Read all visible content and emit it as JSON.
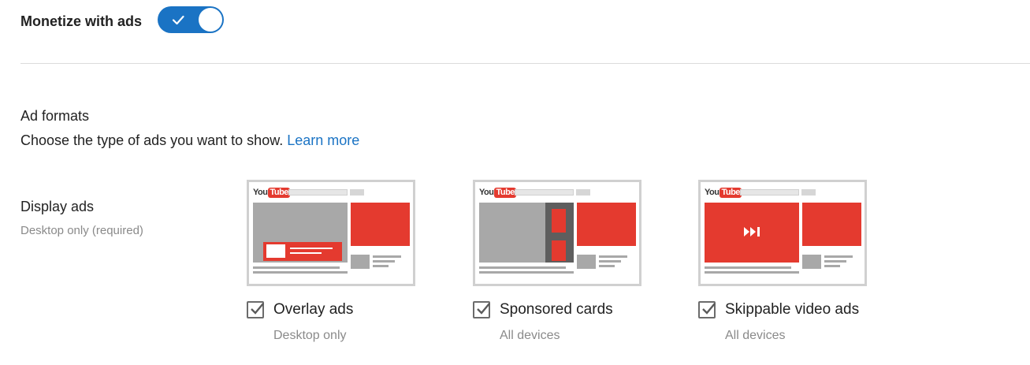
{
  "monetize": {
    "label": "Monetize with ads",
    "enabled": true
  },
  "ad_formats": {
    "title": "Ad formats",
    "description": "Choose the type of ads you want to show.",
    "learn_more": "Learn more"
  },
  "display_ads": {
    "title": "Display ads",
    "subtitle": "Desktop only (required)"
  },
  "formats": [
    {
      "label": "Overlay ads",
      "sub": "Desktop only",
      "checked": true
    },
    {
      "label": "Sponsored cards",
      "sub": "All devices",
      "checked": true
    },
    {
      "label": "Skippable video ads",
      "sub": "All devices",
      "checked": true
    }
  ],
  "illustration": {
    "logo_you": "You",
    "logo_tube": "Tube"
  },
  "colors": {
    "accent": "#1a73c4",
    "ad_red": "#e43a2f",
    "placeholder_gray": "#a8a8a8"
  },
  "icons": {
    "toggle": "check-icon",
    "checkbox": "check-icon",
    "skip": "skip-forward-icon"
  }
}
